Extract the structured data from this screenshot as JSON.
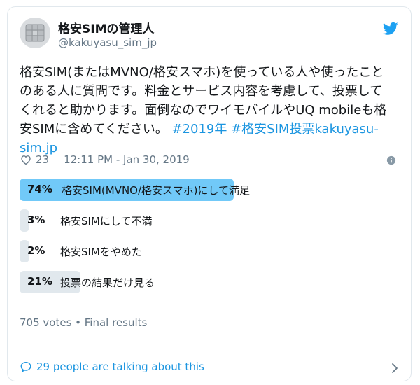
{
  "user": {
    "name": "格安SIMの管理人",
    "handle": "@kakuyasu_sim_jp"
  },
  "tweet": {
    "text": "格安SIM(またはMVNO/格安スマホ)を使っている人や使ったことのある人に質問です。料金とサービス内容を考慮して、投票してくれると助かります。面倒なのでワイモバイルやUQ mobileも格安SIMに含めてください。",
    "hashtag_1": "#2019年",
    "hashtag_2": "#格安SIM投票",
    "link": "kakuyasu-sim.jp"
  },
  "meta": {
    "likes": "23",
    "timestamp": "12:11 PM - Jan 30, 2019"
  },
  "poll": {
    "options": [
      {
        "percent_label": "74%",
        "label": "格安SIM(MVNO/格安スマホ)にして満足",
        "fraction": 0.74,
        "winner": true
      },
      {
        "percent_label": "3%",
        "label": "格安SIMにして不満",
        "fraction": 0.03,
        "winner": false
      },
      {
        "percent_label": "2%",
        "label": "格安SIMをやめた",
        "fraction": 0.02,
        "winner": false
      },
      {
        "percent_label": "21%",
        "label": "投票の結果だけ見る",
        "fraction": 0.21,
        "winner": false
      }
    ],
    "totals": "705 votes • Final results"
  },
  "footer": {
    "talking_text": "29 people are talking about this"
  },
  "colors": {
    "brand_blue": "#1da1f2",
    "link_blue": "#1b95e0",
    "winner_bar": "#71c9f8",
    "bar": "#e1e8ed",
    "muted_text": "#657786"
  },
  "icons": [
    "sim-card-avatar",
    "twitter-bird-icon",
    "heart-icon",
    "info-icon",
    "speech-bubble-icon",
    "chevron-right-icon"
  ]
}
